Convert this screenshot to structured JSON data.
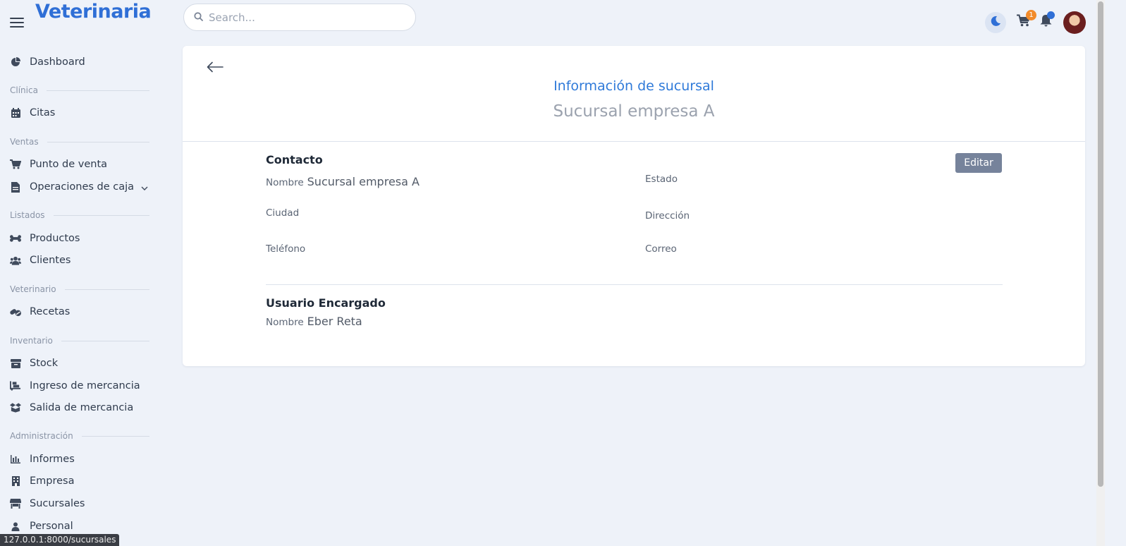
{
  "brand": "Veterinaria",
  "search": {
    "placeholder": "Search..."
  },
  "topbar": {
    "cart_count": "1"
  },
  "sidebar": {
    "dashboard": "Dashboard",
    "sections": {
      "clinica": "Clínica",
      "ventas": "Ventas",
      "listados": "Listados",
      "veterinario": "Veterinario",
      "inventario": "Inventario",
      "administracion": "Administración"
    },
    "items": {
      "citas": "Citas",
      "punto_venta": "Punto de venta",
      "operaciones_caja": "Operaciones de caja",
      "productos": "Productos",
      "clientes": "Clientes",
      "recetas": "Recetas",
      "stock": "Stock",
      "ingreso": "Ingreso de mercancia",
      "salida": "Salida de mercancia",
      "informes": "Informes",
      "empresa": "Empresa",
      "sucursales": "Sucursales",
      "personal": "Personal"
    }
  },
  "card": {
    "title": "Información de sucursal",
    "subtitle": "Sucursal empresa A",
    "contact_heading": "Contacto",
    "edit_label": "Editar",
    "fields": {
      "nombre_label": "Nombre",
      "nombre_value": "Sucursal empresa A",
      "estado_label": "Estado",
      "ciudad_label": "Ciudad",
      "direccion_label": "Dirección",
      "telefono_label": "Teléfono",
      "correo_label": "Correo"
    },
    "manager_heading": "Usuario Encargado",
    "manager": {
      "nombre_label": "Nombre",
      "nombre_value": "Eber Reta"
    }
  },
  "status_url": "127.0.0.1:8000/sucursales"
}
